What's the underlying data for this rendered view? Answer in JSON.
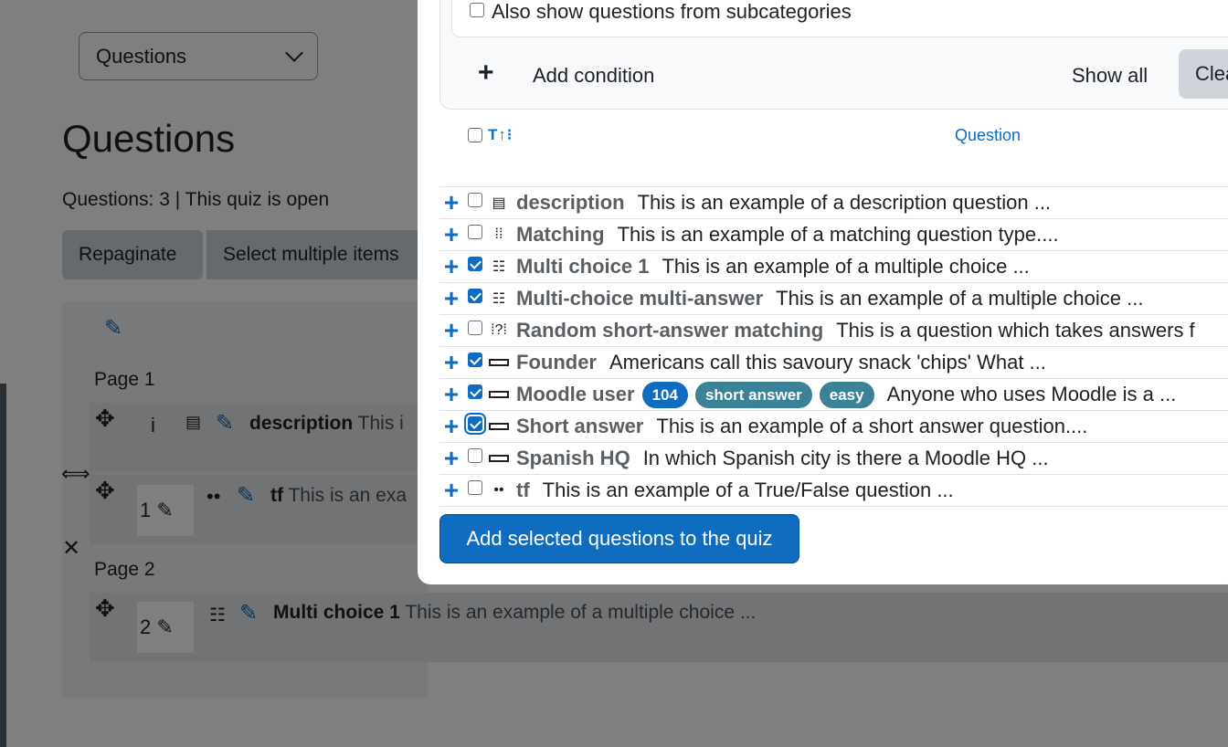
{
  "background": {
    "select_value": "Questions",
    "page_title": "Questions",
    "status": "Questions: 3 | This quiz is open",
    "buttons": {
      "repaginate": "Repaginate",
      "select_multiple": "Select multiple items"
    },
    "page1_label": "Page 1",
    "page2_label": "Page 2",
    "slots": [
      {
        "number": "",
        "info": "i",
        "name": "description",
        "text": "This i"
      },
      {
        "number": "1",
        "name": "tf",
        "text": "This is an exa"
      },
      {
        "number": "2",
        "name": "Multi choice 1",
        "text": "This is an example of a multiple choice ..."
      }
    ]
  },
  "modal": {
    "subcategories_label": "Also show questions from subcategories",
    "add_condition": "Add condition",
    "show_all": "Show all",
    "clear": "Clea",
    "sort_label": "T",
    "column_question": "Question",
    "questions": [
      {
        "checked": false,
        "icon": "description-icon",
        "name": "description",
        "text": "This is an example of a description question ..."
      },
      {
        "checked": false,
        "icon": "matching-icon",
        "name": "Matching",
        "text": "This is an example of a matching question type...."
      },
      {
        "checked": true,
        "icon": "multichoice-icon",
        "name": "Multi choice 1",
        "text": "This is an example of a multiple choice ..."
      },
      {
        "checked": true,
        "icon": "multichoice-icon",
        "name": "Multi-choice multi-answer",
        "text": "This is an example of a multiple choice ..."
      },
      {
        "checked": false,
        "icon": "random-matching-icon",
        "name": "Random short-answer matching",
        "text": "This is  a question which takes answers f"
      },
      {
        "checked": true,
        "icon": "shortanswer-icon",
        "name": "Founder",
        "text": "Americans call this savoury snack 'chips' What ..."
      },
      {
        "checked": true,
        "icon": "shortanswer-icon",
        "name": "Moodle user",
        "tags": [
          "104",
          "short answer",
          "easy"
        ],
        "text": "Anyone who uses Moodle is a ..."
      },
      {
        "checked": true,
        "focused": true,
        "icon": "shortanswer-icon",
        "name": "Short answer",
        "text": "This is an example of a short answer question...."
      },
      {
        "checked": false,
        "icon": "shortanswer-icon",
        "name": "Spanish HQ",
        "text": "In which Spanish city is there a Moodle HQ ..."
      },
      {
        "checked": false,
        "icon": "truefalse-icon",
        "name": "tf",
        "text": "This is an example of a True/False question ..."
      }
    ],
    "add_selected_button": "Add selected questions to the quiz"
  },
  "colors": {
    "accent": "#0f6cbf",
    "badge_teal": "#3b8296",
    "overlay": "rgba(0,0,0,0.5)"
  }
}
